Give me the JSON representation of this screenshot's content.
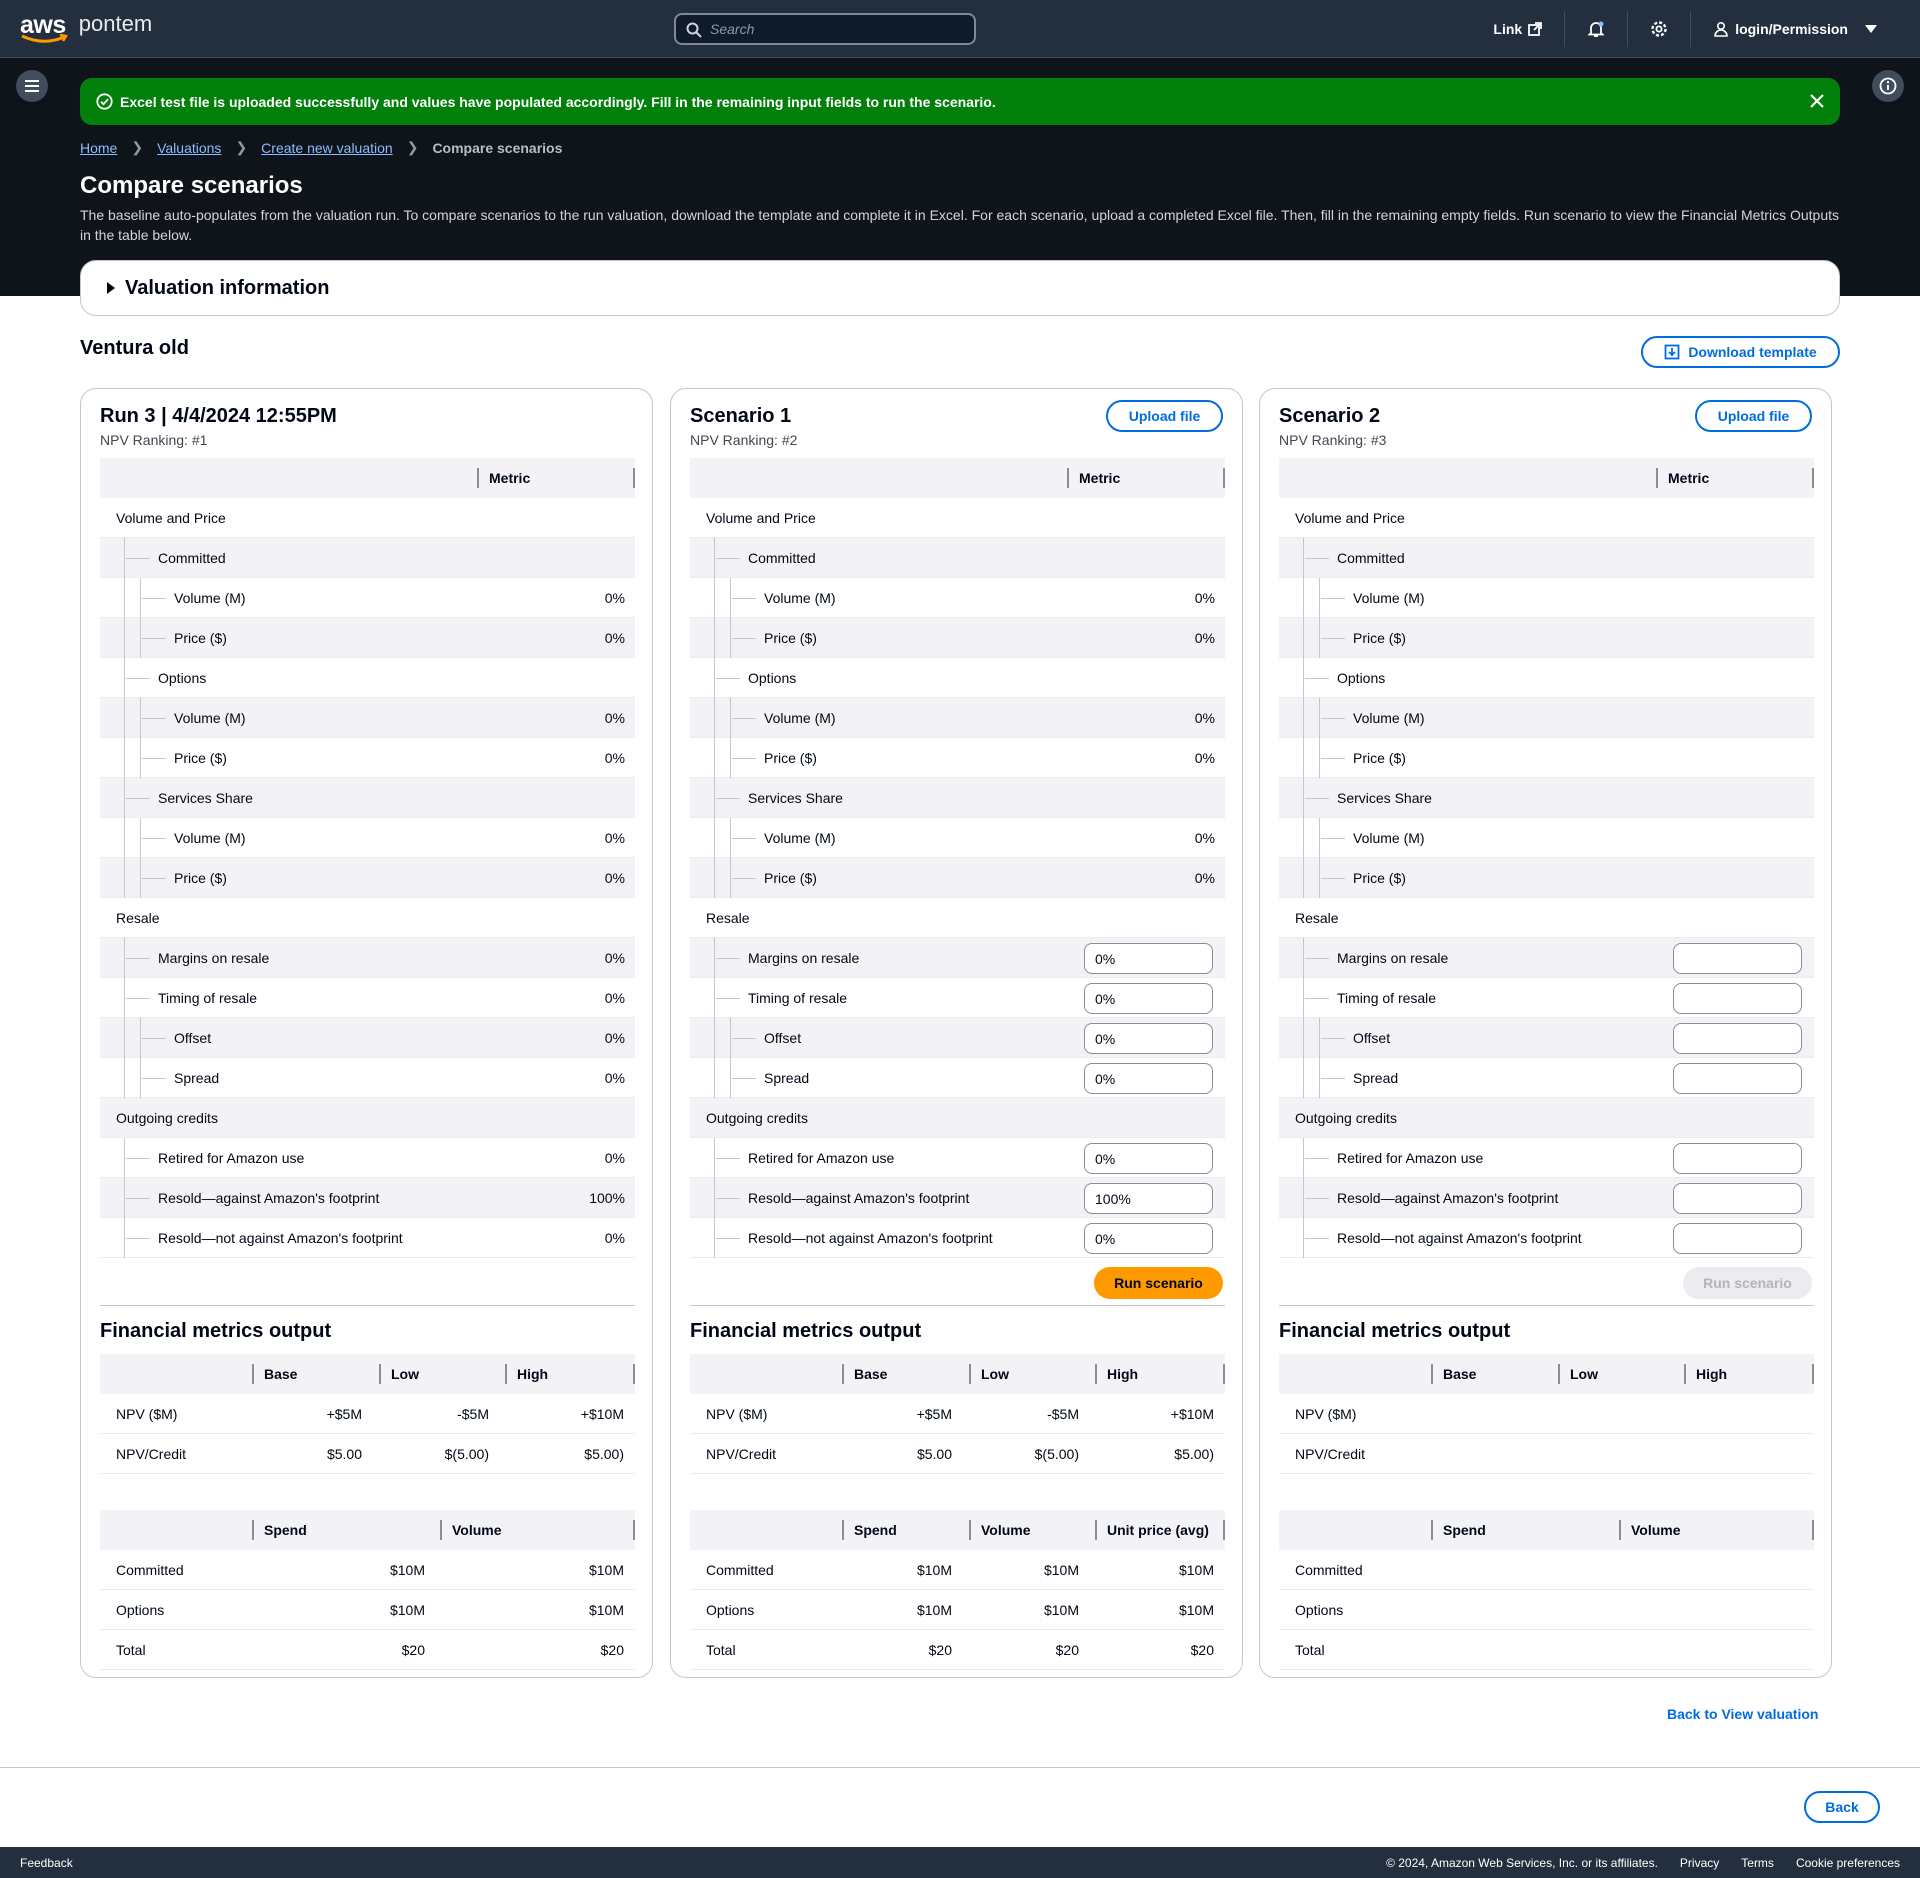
{
  "nav": {
    "brand": "pontem",
    "search_placeholder": "Search",
    "link_label": "Link",
    "user_label": "login/Permission"
  },
  "flash": {
    "message": "Excel test file is uploaded successfully and values have populated accordingly. Fill in the remaining input fields to run the scenario."
  },
  "breadcrumbs": [
    "Home",
    "Valuations",
    "Create new valuation",
    "Compare scenarios"
  ],
  "page": {
    "title": "Compare scenarios",
    "description": "The baseline auto-populates from the valuation run. To compare scenarios to the run valuation, download the template and complete it in Excel. For each scenario, upload a completed Excel file. Then, fill in the remaining empty fields. Run scenario to view the Financial Metrics Outputs in the table below.",
    "valuation_info_label": "Valuation information",
    "section_title": "Ventura old",
    "download_template_label": "Download template",
    "back_to_view_label": "Back to View valuation",
    "back_label": "Back"
  },
  "metric_header": "Metric",
  "metric_rows": [
    {
      "label": "Volume and Price",
      "level": 0
    },
    {
      "label": "Committed",
      "level": 1
    },
    {
      "label": "Volume (M)",
      "level": 2
    },
    {
      "label": "Price ($)",
      "level": 2
    },
    {
      "label": "Options",
      "level": 1
    },
    {
      "label": "Volume (M)",
      "level": 2
    },
    {
      "label": "Price ($)",
      "level": 2
    },
    {
      "label": "Services Share",
      "level": 1
    },
    {
      "label": "Volume (M)",
      "level": 2
    },
    {
      "label": "Price ($)",
      "level": 2
    },
    {
      "label": "Resale",
      "level": 0
    },
    {
      "label": "Margins on resale",
      "level": 1
    },
    {
      "label": "Timing of resale",
      "level": 1
    },
    {
      "label": "Offset",
      "level": 2
    },
    {
      "label": "Spread",
      "level": 2
    },
    {
      "label": "Outgoing credits",
      "level": 0
    },
    {
      "label": "Retired for Amazon use",
      "level": 1
    },
    {
      "label": "Resold—against Amazon's footprint",
      "level": 1
    },
    {
      "label": "Resold—not against Amazon's footprint",
      "level": 1
    }
  ],
  "fm_title": "Financial metrics output",
  "fm_headers": [
    "Base",
    "Low",
    "High"
  ],
  "fm_row_labels": [
    "NPV ($M)",
    "NPV/Credit"
  ],
  "sv_row_labels": [
    "Committed",
    "Options",
    "Total"
  ],
  "upload_label": "Upload file",
  "run_label": "Run scenario",
  "cards": [
    {
      "title": "Run 3 | 4/4/2024 12:55PM",
      "rank": "NPV Ranking: #1",
      "values": [
        "",
        "",
        "0%",
        "0%",
        "",
        "0%",
        "0%",
        "",
        "0%",
        "0%",
        "",
        "0%",
        "0%",
        "0%",
        "0%",
        "",
        "0%",
        "100%",
        "0%"
      ],
      "inputs": [],
      "fm_values": [
        [
          "+$5M",
          "-$5M",
          "+$10M"
        ],
        [
          "$5.00",
          "$(5.00)",
          "$5.00)"
        ]
      ],
      "sv_headers": [
        "Spend",
        "Volume"
      ],
      "sv_values": [
        [
          "$10M",
          "$10M"
        ],
        [
          "$10M",
          "$10M"
        ],
        [
          "$20",
          "$20"
        ]
      ]
    },
    {
      "title": "Scenario 1",
      "rank": "NPV Ranking: #2",
      "values": [
        "",
        "",
        "0%",
        "0%",
        "",
        "0%",
        "0%",
        "",
        "0%",
        "0%",
        "",
        "",
        "",
        "",
        "",
        "",
        "",
        "",
        ""
      ],
      "inputs": [
        "",
        "",
        "",
        "",
        "",
        "",
        "",
        "",
        "",
        "",
        "",
        "0%",
        "0%",
        "0%",
        "0%",
        "",
        "0%",
        "100%",
        "0%"
      ],
      "fm_values": [
        [
          "+$5M",
          "-$5M",
          "+$10M"
        ],
        [
          "$5.00",
          "$(5.00)",
          "$5.00)"
        ]
      ],
      "sv_headers": [
        "Spend",
        "Volume",
        "Unit price (avg)"
      ],
      "sv_values": [
        [
          "$10M",
          "$10M",
          "$10M"
        ],
        [
          "$10M",
          "$10M",
          "$10M"
        ],
        [
          "$20",
          "$20",
          "$20"
        ]
      ]
    },
    {
      "title": "Scenario 2",
      "rank": "NPV Ranking: #3",
      "values": [
        "",
        "",
        "",
        "",
        "",
        "",
        "",
        "",
        "",
        "",
        "",
        "",
        "",
        "",
        "",
        "",
        "",
        "",
        ""
      ],
      "inputs": [
        "",
        "",
        "",
        "",
        "",
        "",
        "",
        "",
        "",
        "",
        "",
        "",
        "",
        "",
        "",
        "",
        "",
        "",
        ""
      ],
      "fm_values": [
        [
          "",
          "",
          ""
        ],
        [
          "",
          "",
          ""
        ]
      ],
      "sv_headers": [
        "Spend",
        "Volume"
      ],
      "sv_values": [
        [
          "",
          ""
        ],
        [
          "",
          ""
        ],
        [
          "",
          ""
        ]
      ]
    }
  ],
  "footer": {
    "feedback": "Feedback",
    "copyright": "© 2024, Amazon Web Services, Inc. or its affiliates.",
    "links": [
      "Privacy",
      "Terms",
      "Cookie preferences"
    ]
  }
}
